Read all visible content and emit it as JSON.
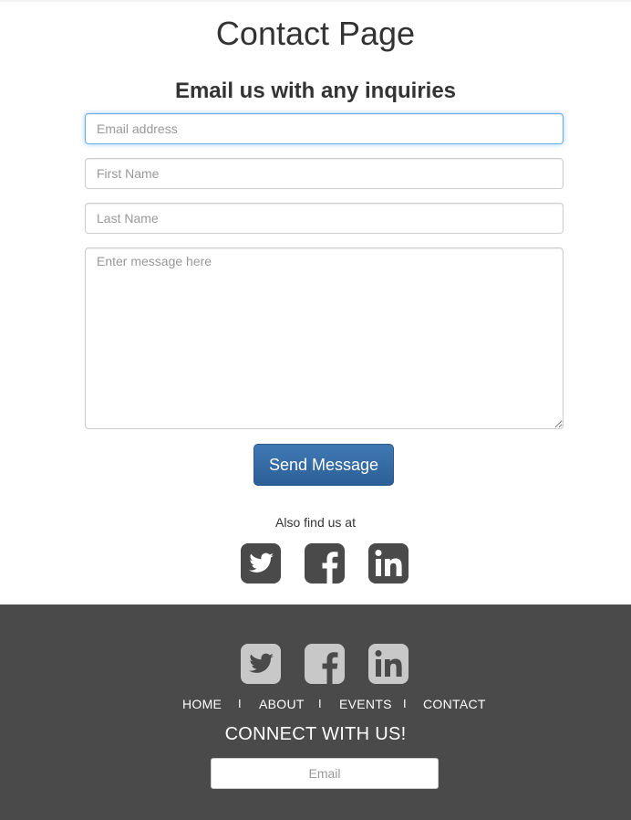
{
  "page": {
    "title": "Contact Page",
    "form_heading": "Email us with any inquiries"
  },
  "form": {
    "email_placeholder": "Email address",
    "first_name_placeholder": "First Name",
    "last_name_placeholder": "Last Name",
    "message_placeholder": "Enter message here",
    "send_label": "Send Message"
  },
  "social": {
    "caption": "Also find us at",
    "icons": [
      "twitter-icon",
      "facebook-icon",
      "linkedin-icon"
    ],
    "icon_color_dark": "#4a4a4a",
    "icon_color_light": "#c8c8c8"
  },
  "footer": {
    "nav": [
      {
        "label": "HOME"
      },
      {
        "label": "ABOUT"
      },
      {
        "label": "EVENTS"
      },
      {
        "label": "CONTACT"
      }
    ],
    "separator": "I",
    "connect_label": "CONNECT WITH US!",
    "email_placeholder": "Email",
    "background": "#4a4a4a"
  },
  "colors": {
    "button": "#2c5f96",
    "focus": "#66afe9"
  }
}
